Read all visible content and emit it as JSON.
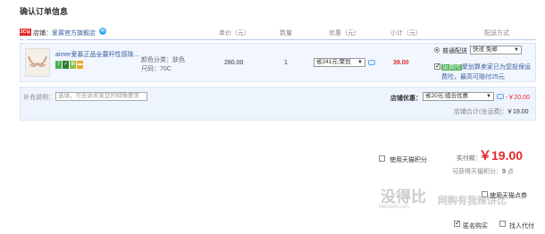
{
  "page_title": "确认订单信息",
  "columns": {
    "price": "单价（元）",
    "qty": "数量",
    "discount": "优惠（元）",
    "subtotal": "小计（元）",
    "shipping": "配送方式"
  },
  "shop": {
    "badge": "3C认证",
    "label": "店铺：",
    "name": "爱慕官方旗舰店"
  },
  "item": {
    "name": "aimer爱慕正品全蕾杆性感珠...",
    "color_label": "颜色分类：肤色",
    "size_label": "尺码：70C",
    "price": "280.00",
    "qty": "1",
    "discount_select": "省241元:聚划",
    "subtotal": "39.00",
    "shipping_option": "普通配送",
    "shipping_select": "快递 免邮",
    "insurance_tag": "运费险",
    "insurance_text": "聚划算卖家已为您投保运费险，最高可赔付25元"
  },
  "memo": {
    "label": "补充说明：",
    "placeholder": "选填，可告诉卖家您的特殊要求"
  },
  "shop_discount": {
    "label": "店铺优惠：",
    "select": "省20元:组合优惠",
    "amount": "-￥20.00",
    "total_label": "店铺合计(含运费)：",
    "total": "￥19.00"
  },
  "tmall_points": {
    "label": "使用天猫积分"
  },
  "payment": {
    "label": "实付款：",
    "amount": "￥19.00",
    "points_label": "可获得天猫积分：",
    "points": "9",
    "points_unit": "点"
  },
  "tmall_coupon": {
    "label": "使用天猫点券"
  },
  "bottom": {
    "anonymous": "匿名购买",
    "proxy_pay": "找人代付"
  },
  "watermark": {
    "text": "没得比",
    "subtext": "Meidebi.com",
    "tagline": "网购有我辣饼比"
  }
}
